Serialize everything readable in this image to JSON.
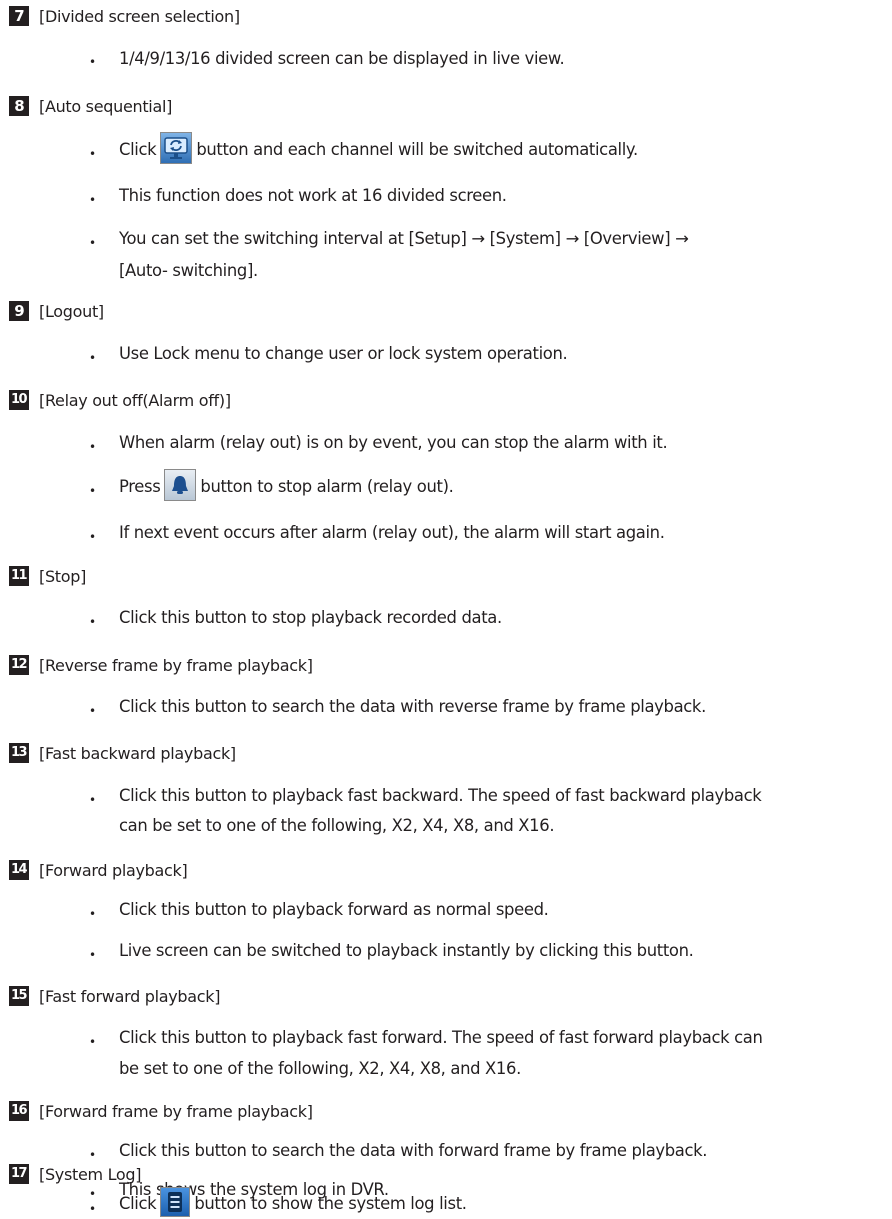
{
  "sections": [
    {
      "num": "7",
      "title": "[Divided screen selection]",
      "items": [
        {
          "text": "1/4/9/13/16 divided screen can be displayed in live view."
        }
      ]
    },
    {
      "num": "8",
      "title": "[Auto sequential]",
      "items": [
        {
          "before": "Click",
          "icon": "auto-sequential-monitor-icon",
          "after": "button and each channel will be switched automatically."
        },
        {
          "text": "This function does not work at 16 divided screen."
        },
        {
          "line1": "You can set the switching interval at [Setup] → [System] → [Overview] →",
          "line2": "[Auto- switching]."
        }
      ]
    },
    {
      "num": "9",
      "title": "[Logout]",
      "items": [
        {
          "text": "Use Lock menu to change user or lock system operation."
        }
      ]
    },
    {
      "num": "10",
      "title": "[Relay out off(Alarm off)]",
      "items": [
        {
          "text": "When alarm (relay out) is on by event, you can stop the alarm with it."
        },
        {
          "before": "Press",
          "icon": "alarm-bell-icon",
          "after": "button to stop alarm (relay out)."
        },
        {
          "text": "If next event occurs after alarm (relay out), the alarm will start again."
        }
      ]
    },
    {
      "num": "11",
      "title": "[Stop]",
      "items": [
        {
          "text": "Click this button to stop playback recorded data."
        }
      ]
    },
    {
      "num": "12",
      "title": "[Reverse frame by frame playback]",
      "items": [
        {
          "text": "Click this button to search the data with reverse frame by frame playback."
        }
      ]
    },
    {
      "num": "13",
      "title": "[Fast backward playback]",
      "items": [
        {
          "line1": "Click this button to playback fast backward. The speed of fast backward playback",
          "line2": "can be set to one of the following, X2, X4, X8, and X16."
        }
      ]
    },
    {
      "num": "14",
      "title": "[Forward playback]",
      "items": [
        {
          "text": "Click this button to playback forward as normal speed."
        },
        {
          "text": "Live screen can be switched to playback instantly by clicking this button."
        }
      ]
    },
    {
      "num": "15",
      "title": "[Fast forward playback]",
      "items": [
        {
          "line1": "Click this button to playback fast forward. The speed of fast forward playback can",
          "line2": "be set to one of the following, X2, X4, X8, and X16."
        }
      ]
    },
    {
      "num": "16",
      "title": "[Forward frame by frame playback]",
      "items": [
        {
          "text": "Click this button to search the data with forward frame by frame playback."
        }
      ]
    },
    {
      "num": "17",
      "title": "[System Log]",
      "items": [
        {
          "text": "This shows the system log in DVR."
        },
        {
          "before": "Click",
          "icon": "system-log-list-icon",
          "after": "button to show the system log list."
        }
      ]
    }
  ],
  "bullet_char": "•"
}
